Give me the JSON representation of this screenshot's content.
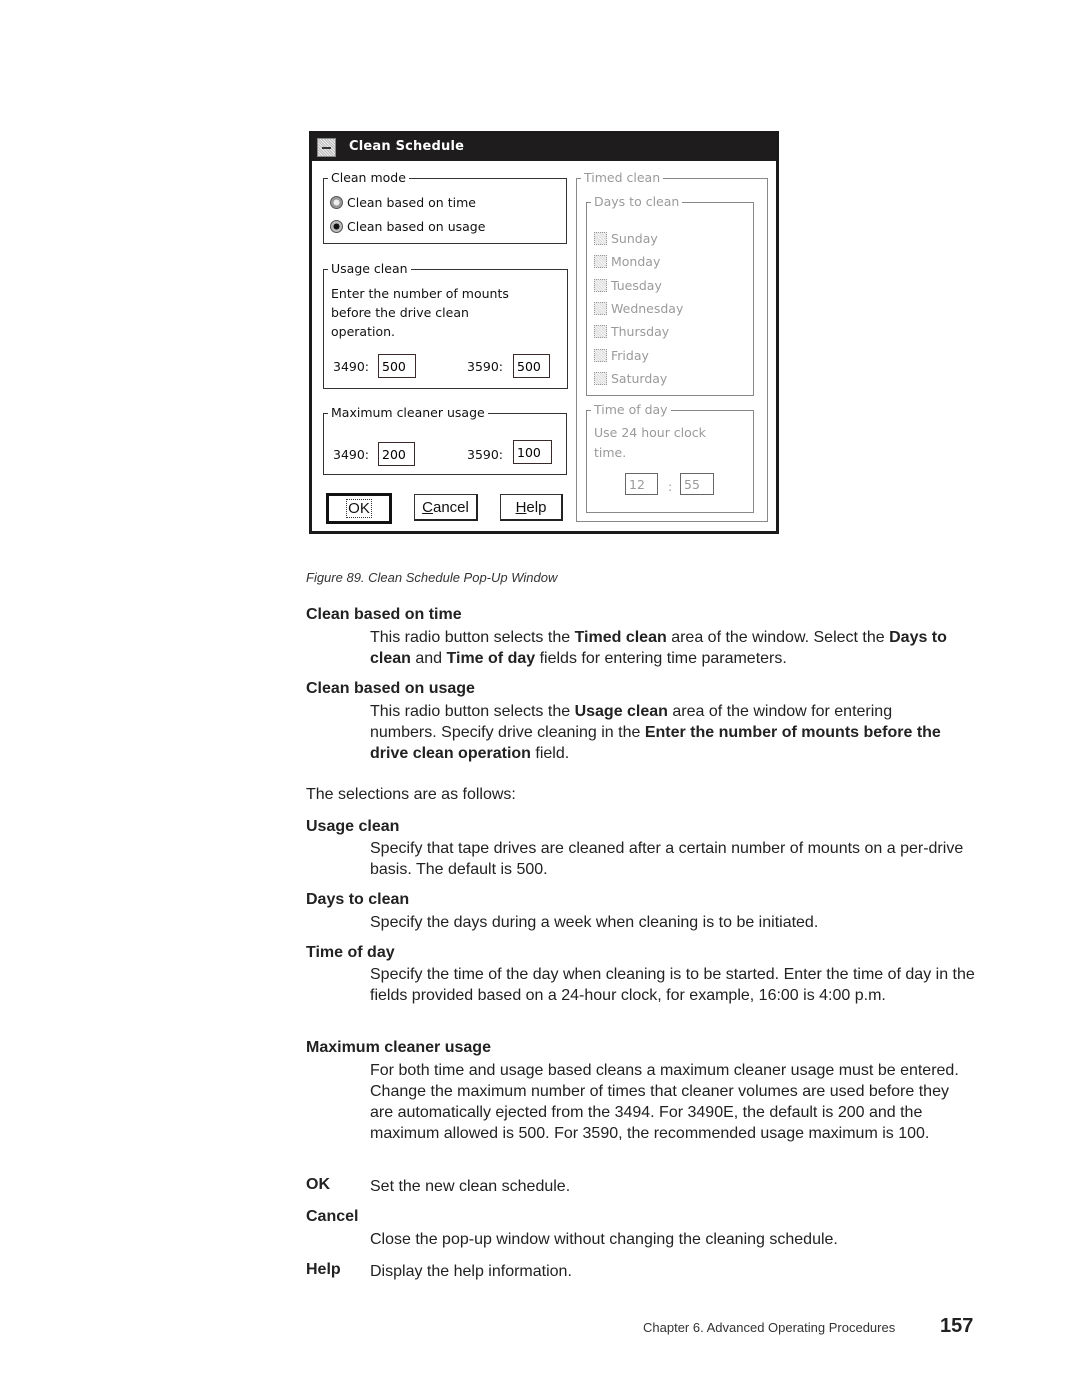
{
  "dialog": {
    "title": "Clean Schedule",
    "clean_mode": {
      "label": "Clean mode",
      "options": [
        {
          "label": "Clean based on time",
          "selected": false
        },
        {
          "label": "Clean based on usage",
          "selected": true
        }
      ]
    },
    "usage_clean": {
      "label": "Usage clean",
      "instructions_line1": "Enter the number of mounts",
      "instructions_line2": "before the drive clean",
      "instructions_line3": "operation.",
      "field_3490_label": "3490:",
      "field_3490_value": "500",
      "field_3590_label": "3590:",
      "field_3590_value": "500"
    },
    "max_cleaner_usage": {
      "label": "Maximum cleaner usage",
      "field_3490_label": "3490:",
      "field_3490_value": "200",
      "field_3590_label": "3590:",
      "field_3590_value": "100"
    },
    "timed_clean": {
      "label": "Timed clean",
      "enabled": false,
      "days_to_clean": {
        "label": "Days to clean",
        "days": [
          {
            "label": "Sunday",
            "checked": false
          },
          {
            "label": "Monday",
            "checked": false
          },
          {
            "label": "Tuesday",
            "checked": false
          },
          {
            "label": "Wednesday",
            "checked": false
          },
          {
            "label": "Thursday",
            "checked": false
          },
          {
            "label": "Friday",
            "checked": false
          },
          {
            "label": "Saturday",
            "checked": false
          }
        ]
      },
      "time_of_day": {
        "label": "Time of day",
        "hint_line1": "Use 24 hour clock",
        "hint_line2": "time.",
        "hour": "12",
        "separator": ":",
        "minute": "55"
      }
    },
    "buttons": {
      "ok": "OK",
      "cancel_first": "C",
      "cancel_rest": "ancel",
      "help_first": "H",
      "help_rest": "elp"
    }
  },
  "caption": "Figure 89. Clean Schedule Pop-Up Window",
  "sections": {
    "clean_time": {
      "term": "Clean based on time",
      "p1": "This radio button selects the ",
      "b1": "Timed clean",
      "p2": " area of the window. Select the ",
      "b2": "Days to clean",
      "p3": " and ",
      "b3": "Time of day",
      "p4": " fields for entering time parameters."
    },
    "clean_usage": {
      "term": "Clean based on usage",
      "p1": "This radio button selects the ",
      "b1": "Usage clean",
      "p2": " area of the window for entering numbers. Specify drive cleaning in the ",
      "b2": "Enter the number of mounts before the drive clean operation",
      "p3": " field."
    },
    "intro": "The selections are as follows:",
    "usage_clean": {
      "term": "Usage clean",
      "desc": "Specify that tape drives are cleaned after a certain number of mounts on a per-drive basis. The default is 500."
    },
    "days_to_clean": {
      "term": "Days to clean",
      "desc": "Specify the days during a week when cleaning is to be initiated."
    },
    "time_of_day": {
      "term": "Time of day",
      "desc": "Specify the time of the day when cleaning is to be started. Enter the time of day in the fields provided based on a 24-hour clock, for example, 16:00 is 4:00 p.m."
    },
    "max_usage": {
      "term": "Maximum cleaner usage",
      "desc": "For both time and usage based cleans a maximum cleaner usage must be entered. Change the maximum number of times that cleaner volumes are used before they are automatically ejected from the 3494. For 3490E, the default is 200 and the maximum allowed is 500. For 3590, the recommended usage maximum is 100."
    },
    "ok": {
      "term": "OK",
      "desc": "Set the new clean schedule."
    },
    "cancel": {
      "term": "Cancel",
      "desc": "Close the pop-up window without changing the cleaning schedule."
    },
    "help": {
      "term": "Help",
      "desc": "Display the help information."
    }
  },
  "footer": {
    "chapter": "Chapter 6. Advanced Operating Procedures",
    "page": "157"
  }
}
